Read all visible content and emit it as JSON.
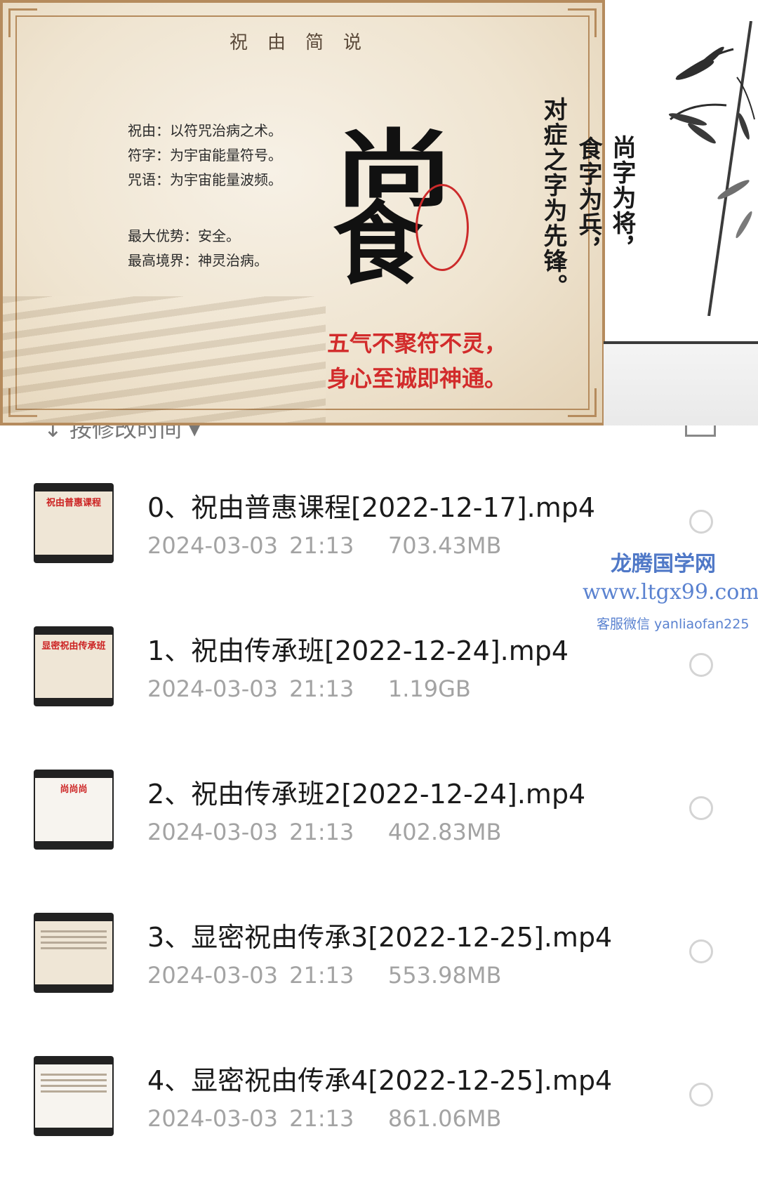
{
  "slide": {
    "title": "祝由简说",
    "definitions": [
      "祝由：以符咒治病之术。",
      "符字：为宇宙能量符号。",
      "咒语：为宇宙能量波频。"
    ],
    "advantages": [
      "最大优势：安全。",
      "最高境界：神灵治病。"
    ],
    "big_chars": [
      "尚",
      "食"
    ],
    "vertical_columns": [
      "尚字为将，",
      "食字为兵，",
      "对症之字为先锋。"
    ],
    "red_lines": [
      "五气不聚符不灵，",
      "身心至诚即神通。"
    ]
  },
  "sort": {
    "label": "按修改时间"
  },
  "files": [
    {
      "name": "0、祝由普惠课程[2022-12-17].mp4",
      "date": "2024-03-03  21:13",
      "size": "703.43MB",
      "thumb_text": "祝由普惠课程"
    },
    {
      "name": "1、祝由传承班[2022-12-24].mp4",
      "date": "2024-03-03  21:13",
      "size": "1.19GB",
      "thumb_text": "显密祝由传承班"
    },
    {
      "name": "2、祝由传承班2[2022-12-24].mp4",
      "date": "2024-03-03  21:13",
      "size": "402.83MB",
      "thumb_text": "尚尚尚"
    },
    {
      "name": "3、显密祝由传承3[2022-12-25].mp4",
      "date": "2024-03-03  21:13",
      "size": "553.98MB",
      "thumb_text": ""
    },
    {
      "name": "4、显密祝由传承4[2022-12-25].mp4",
      "date": "2024-03-03  21:13",
      "size": "861.06MB",
      "thumb_text": ""
    }
  ],
  "watermark": {
    "title": "龙腾国学网",
    "url": "www.ltgx99.com",
    "contact": "客服微信 yanliaofan225"
  },
  "colors": {
    "accent_red": "#d22b2b",
    "watermark_blue": "#4f78c7",
    "meta_gray": "#a3a3a3"
  }
}
